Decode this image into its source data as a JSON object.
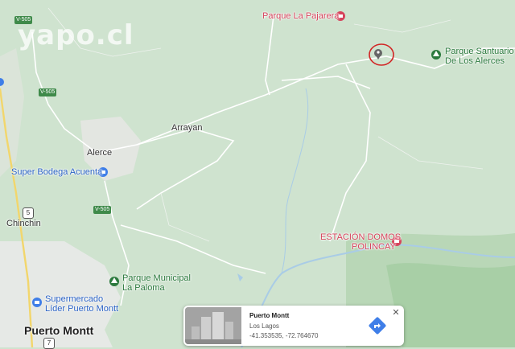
{
  "watermark": "yapo.cl",
  "labels": {
    "parque_pajarera": "Parque La Pajarera",
    "parque_santuario_1": "Parque Santuario",
    "parque_santuario_2": "De Los Alerces",
    "arrayan": "Arrayan",
    "alerce": "Alerce",
    "super_bodega": "Super Bodega Acuenta",
    "chinchin": "Chinchin",
    "estacion_1": "ESTACIÓN DOMOS",
    "estacion_2": "POLINCAY",
    "parque_municipal_1": "Parque Municipal",
    "parque_municipal_2": "La Paloma",
    "supermercado_1": "Supermercado",
    "supermercado_2": "Líder Puerto Montt",
    "puerto_montt": "Puerto Montt"
  },
  "road_shields": {
    "v505_top": "V-505",
    "v505_mid": "V-505",
    "v505_low": "V-505",
    "route5": "5",
    "route7": "7"
  },
  "info_card": {
    "title": "Puerto Montt",
    "subtitle": "Los Lagos",
    "coords": "-41.353535, -72.764670",
    "close_symbol": "✕"
  },
  "colors": {
    "map_green": "#cfe3cf",
    "urban": "#e8ebe8",
    "water": "#a9cce6",
    "poi_red": "#d6435b",
    "poi_green": "#2b7a3d",
    "poi_blue": "#2a62c4",
    "accent_blue": "#3f7ee8"
  },
  "icons": {
    "selected_pin": "map-pin-icon",
    "red_circle": "highlight-circle",
    "directions": "directions-icon"
  }
}
